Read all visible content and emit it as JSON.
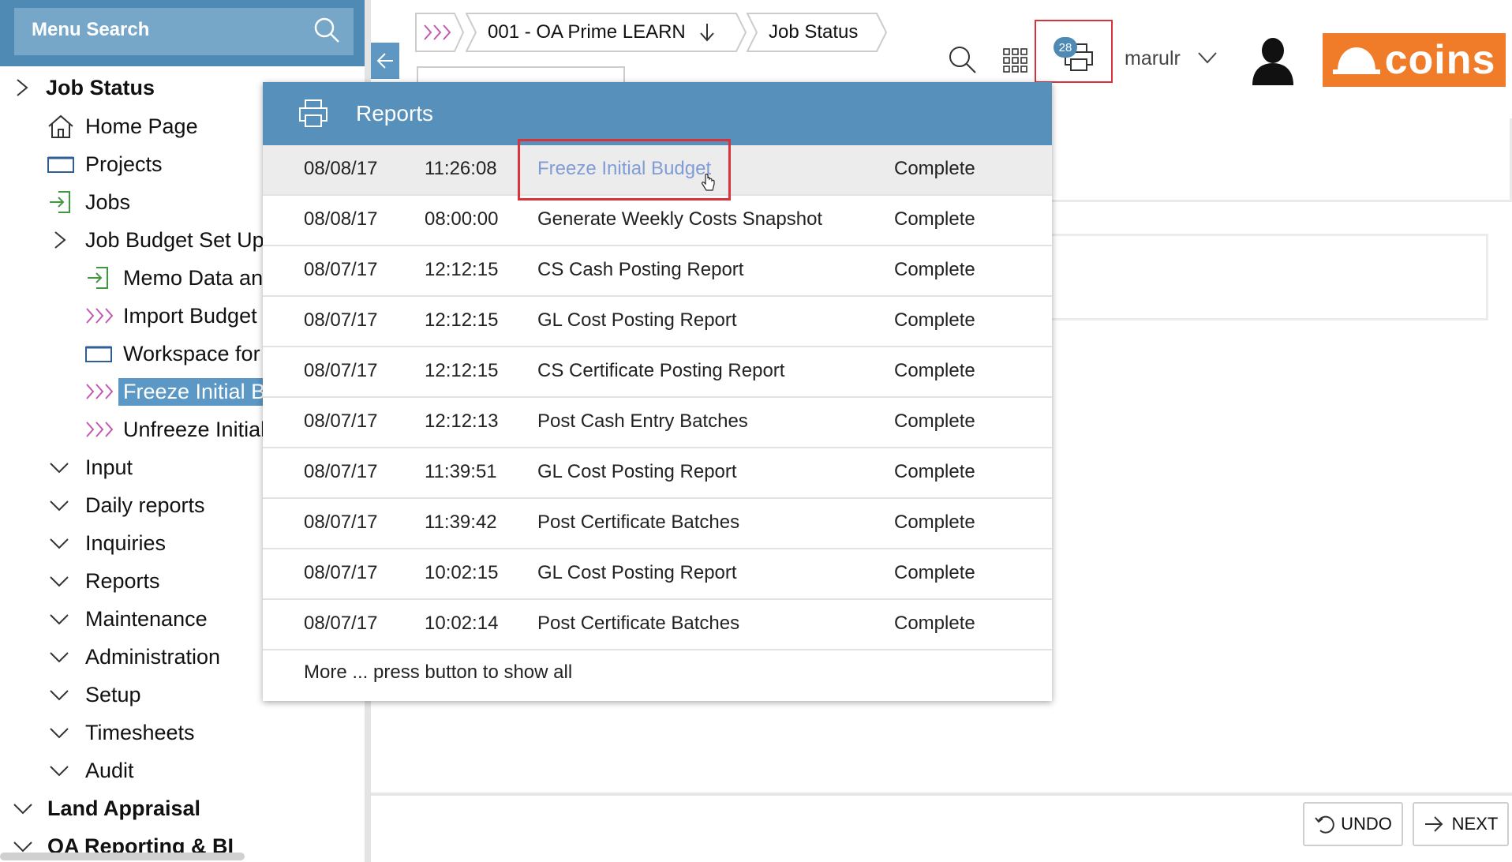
{
  "sidebar": {
    "search_label": "Menu Search",
    "items": [
      {
        "label": "Job Status"
      },
      {
        "label": "Home Page"
      },
      {
        "label": "Projects"
      },
      {
        "label": "Jobs"
      },
      {
        "label": "Job Budget Set Up"
      },
      {
        "label": "Memo Data anc"
      },
      {
        "label": "Import Budget"
      },
      {
        "label": "Workspace for"
      },
      {
        "label": "Freeze Initial Bu"
      },
      {
        "label": "Unfreeze Initial"
      },
      {
        "label": "Input"
      },
      {
        "label": "Daily reports"
      },
      {
        "label": "Inquiries"
      },
      {
        "label": "Reports"
      },
      {
        "label": "Maintenance"
      },
      {
        "label": "Administration"
      },
      {
        "label": "Setup"
      },
      {
        "label": "Timesheets"
      },
      {
        "label": "Audit"
      },
      {
        "label": "Land Appraisal"
      },
      {
        "label": "OA Reporting & BI"
      }
    ]
  },
  "breadcrumb": {
    "company": "001 - OA Prime LEARN",
    "page": "Job Status"
  },
  "toolbar": {
    "print_badge": "28",
    "user_name": "marulr",
    "logo_text": "coins"
  },
  "reports": {
    "title": "Reports",
    "rows": [
      {
        "date": "08/08/17",
        "time": "11:26:08",
        "name": "Freeze Initial Budget",
        "status": "Complete"
      },
      {
        "date": "08/08/17",
        "time": "08:00:00",
        "name": "Generate Weekly Costs Snapshot",
        "status": "Complete"
      },
      {
        "date": "08/07/17",
        "time": "12:12:15",
        "name": "CS Cash Posting Report",
        "status": "Complete"
      },
      {
        "date": "08/07/17",
        "time": "12:12:15",
        "name": "GL Cost Posting Report",
        "status": "Complete"
      },
      {
        "date": "08/07/17",
        "time": "12:12:15",
        "name": "CS Certificate Posting Report",
        "status": "Complete"
      },
      {
        "date": "08/07/17",
        "time": "12:12:13",
        "name": "Post Cash Entry Batches",
        "status": "Complete"
      },
      {
        "date": "08/07/17",
        "time": "11:39:51",
        "name": "GL Cost Posting Report",
        "status": "Complete"
      },
      {
        "date": "08/07/17",
        "time": "11:39:42",
        "name": "Post Certificate Batches",
        "status": "Complete"
      },
      {
        "date": "08/07/17",
        "time": "10:02:15",
        "name": "GL Cost Posting Report",
        "status": "Complete"
      },
      {
        "date": "08/07/17",
        "time": "10:02:14",
        "name": "Post Certificate Batches",
        "status": "Complete"
      }
    ],
    "more_text": "More ... press button to show all"
  },
  "footer": {
    "undo_label": "UNDO",
    "next_label": "NEXT"
  },
  "colors": {
    "accent_blue": "#5791bb",
    "highlight_red": "#d9323a",
    "logo_orange": "#f07c2a",
    "selected_blue": "#5b98c6"
  }
}
